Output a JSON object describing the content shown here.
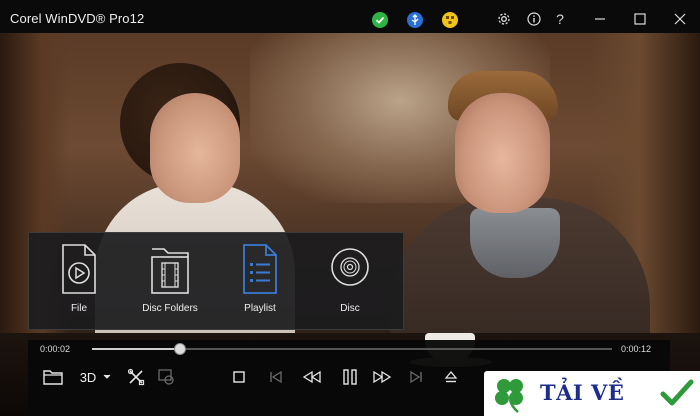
{
  "window": {
    "title": "Corel WinDVD® Pro12",
    "status_icons": [
      "green-check-badge-icon",
      "blue-usb-badge-icon",
      "yellow-network-badge-icon"
    ],
    "buttons": [
      "gear-icon",
      "info-icon",
      "help-icon",
      "minimize-icon",
      "maximize-icon",
      "close-icon"
    ],
    "help_glyph": "?"
  },
  "source_picker": {
    "items": [
      {
        "label": "File",
        "icon": "file-play-icon"
      },
      {
        "label": "Disc Folders",
        "icon": "disc-folder-icon"
      },
      {
        "label": "Playlist",
        "icon": "playlist-icon",
        "selected": true
      },
      {
        "label": "Disc",
        "icon": "disc-icon"
      }
    ],
    "accent_color": "#3a7bd5"
  },
  "playback": {
    "elapsed": "0:00:02",
    "total": "0:00:12",
    "progress": 0.17,
    "mode_3d_label": "3D"
  },
  "watermark": {
    "text": "TẢI VỀ"
  }
}
